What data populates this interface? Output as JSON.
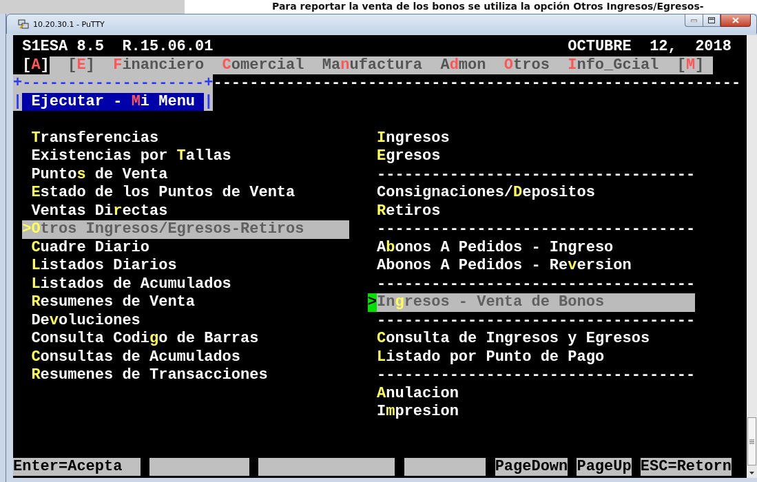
{
  "document_caption": "Para reportar la venta de los bonos se utiliza la opción Otros Ingresos/Egresos-",
  "window": {
    "title": "10.20.30.1 - PuTTY"
  },
  "terminal": {
    "header": {
      "system": "S1ESA 8.5  R.15.06.01",
      "date": "OCTUBRE  12,  2018"
    },
    "menubar": [
      {
        "label": "[**A**]",
        "selected": true
      },
      {
        "label": "[**E**]",
        "selected": false
      },
      {
        "label": "**F**inanciero",
        "selected": false
      },
      {
        "label": "**C**omercial",
        "selected": false
      },
      {
        "label": "Ma**n**ufactura",
        "selected": false
      },
      {
        "label": "A**d**mon",
        "selected": false
      },
      {
        "label": "**O**tros",
        "selected": false
      },
      {
        "label": "**I**nfo_Gcial",
        "selected": false
      },
      {
        "label": "[**M**]",
        "selected": false
      }
    ],
    "submenu_box": {
      "top_border": "+--------------------+",
      "left_edge": "|",
      "title": "Ejecutar - **M**i Menu",
      "right_edge": "|",
      "rule": "----------------------------------------------------------"
    },
    "left_column": [
      {
        "kind": "item",
        "label": "**T**ransferencias",
        "selected": false
      },
      {
        "kind": "item",
        "label": "Existencias por **T**allas",
        "selected": false
      },
      {
        "kind": "item",
        "label": "Punto**s** de Venta",
        "selected": false
      },
      {
        "kind": "item",
        "label": "**E**stado de los Puntos de Venta",
        "selected": false
      },
      {
        "kind": "item",
        "label": "Ventas Di**r**ectas",
        "selected": false
      },
      {
        "kind": "item",
        "label": "**O**tros Ingresos/Egresos-Retiros",
        "selected": true,
        "focused": false,
        "pointer": ">"
      },
      {
        "kind": "item",
        "label": "**C**uadre Diario",
        "selected": false
      },
      {
        "kind": "item",
        "label": "**L**istados Diarios",
        "selected": false
      },
      {
        "kind": "item",
        "label": "**L**istados de Acumulados",
        "selected": false
      },
      {
        "kind": "item",
        "label": "**R**esumenes de Venta",
        "selected": false
      },
      {
        "kind": "item",
        "label": "De**v**oluciones",
        "selected": false
      },
      {
        "kind": "item",
        "label": "Consulta Codi**g**o de Barras",
        "selected": false
      },
      {
        "kind": "item",
        "label": "**C**onsultas de Acumulados",
        "selected": false
      },
      {
        "kind": "item",
        "label": "**R**esumenes de Transacciones",
        "selected": false
      }
    ],
    "right_column": [
      {
        "kind": "item",
        "label": "**I**ngresos",
        "selected": false
      },
      {
        "kind": "item",
        "label": "**E**gresos",
        "selected": false
      },
      {
        "kind": "separator",
        "label": "-----------------------------------"
      },
      {
        "kind": "item",
        "label": "Consignaciones/**D**epositos",
        "selected": false
      },
      {
        "kind": "item",
        "label": "**R**etiros",
        "selected": false
      },
      {
        "kind": "separator",
        "label": "-----------------------------------"
      },
      {
        "kind": "item",
        "label": "A**b**onos A Pedidos - Ingreso",
        "selected": false
      },
      {
        "kind": "item",
        "label": "Abonos A Pedidos - Re**v**ersion",
        "selected": false
      },
      {
        "kind": "separator",
        "label": "-----------------------------------"
      },
      {
        "kind": "item",
        "label": "In**g**resos - Venta de Bonos",
        "selected": true,
        "focused": true,
        "pointer": ">"
      },
      {
        "kind": "separator",
        "label": "-----------------------------------"
      },
      {
        "kind": "item",
        "label": "**C**onsulta de Ingresos y Egresos",
        "selected": false
      },
      {
        "kind": "item",
        "label": "**L**istado por Punto de Pago",
        "selected": false
      },
      {
        "kind": "separator",
        "label": "-----------------------------------"
      },
      {
        "kind": "item",
        "label": "**A**nulacion",
        "selected": false
      },
      {
        "kind": "item",
        "label": "I**m**presion",
        "selected": false
      }
    ],
    "function_keys": [
      {
        "kind": "key",
        "label": "Enter=Acepta"
      },
      {
        "kind": "blank"
      },
      {
        "kind": "blank"
      },
      {
        "kind": "blank"
      },
      {
        "kind": "key",
        "label": "PageDown"
      },
      {
        "kind": "key",
        "label": "PageUp"
      },
      {
        "kind": "key",
        "label": "ESC=Retorn"
      }
    ]
  }
}
